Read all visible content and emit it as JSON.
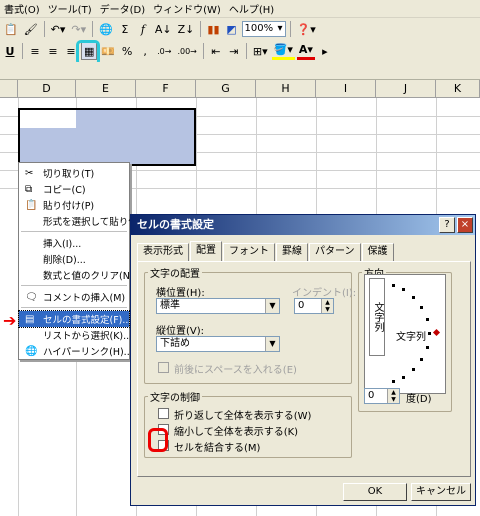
{
  "menu": [
    "書式(O)",
    "ツール(T)",
    "データ(D)",
    "ウィンドウ(W)",
    "ヘルプ(H)"
  ],
  "toolbar": {
    "zoom": "100%",
    "sum": "Σ",
    "fx": "f",
    "percent": "%",
    "comma": ","
  },
  "columns": [
    "D",
    "E",
    "F",
    "G",
    "H",
    "I",
    "J",
    "K"
  ],
  "context_menu": [
    "切り取り(T)",
    "コピー(C)",
    "貼り付け(P)",
    "形式を選択して貼り付",
    "挿入(I)...",
    "削除(D)...",
    "数式と値のクリア(N)",
    "コメントの挿入(M)",
    "セルの書式設定(F)...",
    "リストから選択(K)...",
    "ハイパーリンク(H)..."
  ],
  "dialog": {
    "title": "セルの書式設定",
    "help": "?",
    "close": "×",
    "tabs": [
      "表示形式",
      "配置",
      "フォント",
      "罫線",
      "パターン",
      "保護"
    ],
    "text_alignment": "文字の配置",
    "horizontal_label": "横位置(H):",
    "horizontal_value": "標準",
    "indent_label": "インデント(I):",
    "indent_value": "0",
    "vertical_label": "縦位置(V):",
    "vertical_value": "下詰め",
    "justify_distributed": "前後にスペースを入れる(E)",
    "orientation": "方向",
    "orientation_vertical": "文字列",
    "orientation_text": "文字列",
    "degrees_value": "0",
    "degrees_label": "度(D)",
    "text_control": "文字の制御",
    "wrap": "折り返して全体を表示する(W)",
    "shrink": "縮小して全体を表示する(K)",
    "merge": "セルを結合する(M)",
    "ok": "OK",
    "cancel": "キャンセル"
  }
}
